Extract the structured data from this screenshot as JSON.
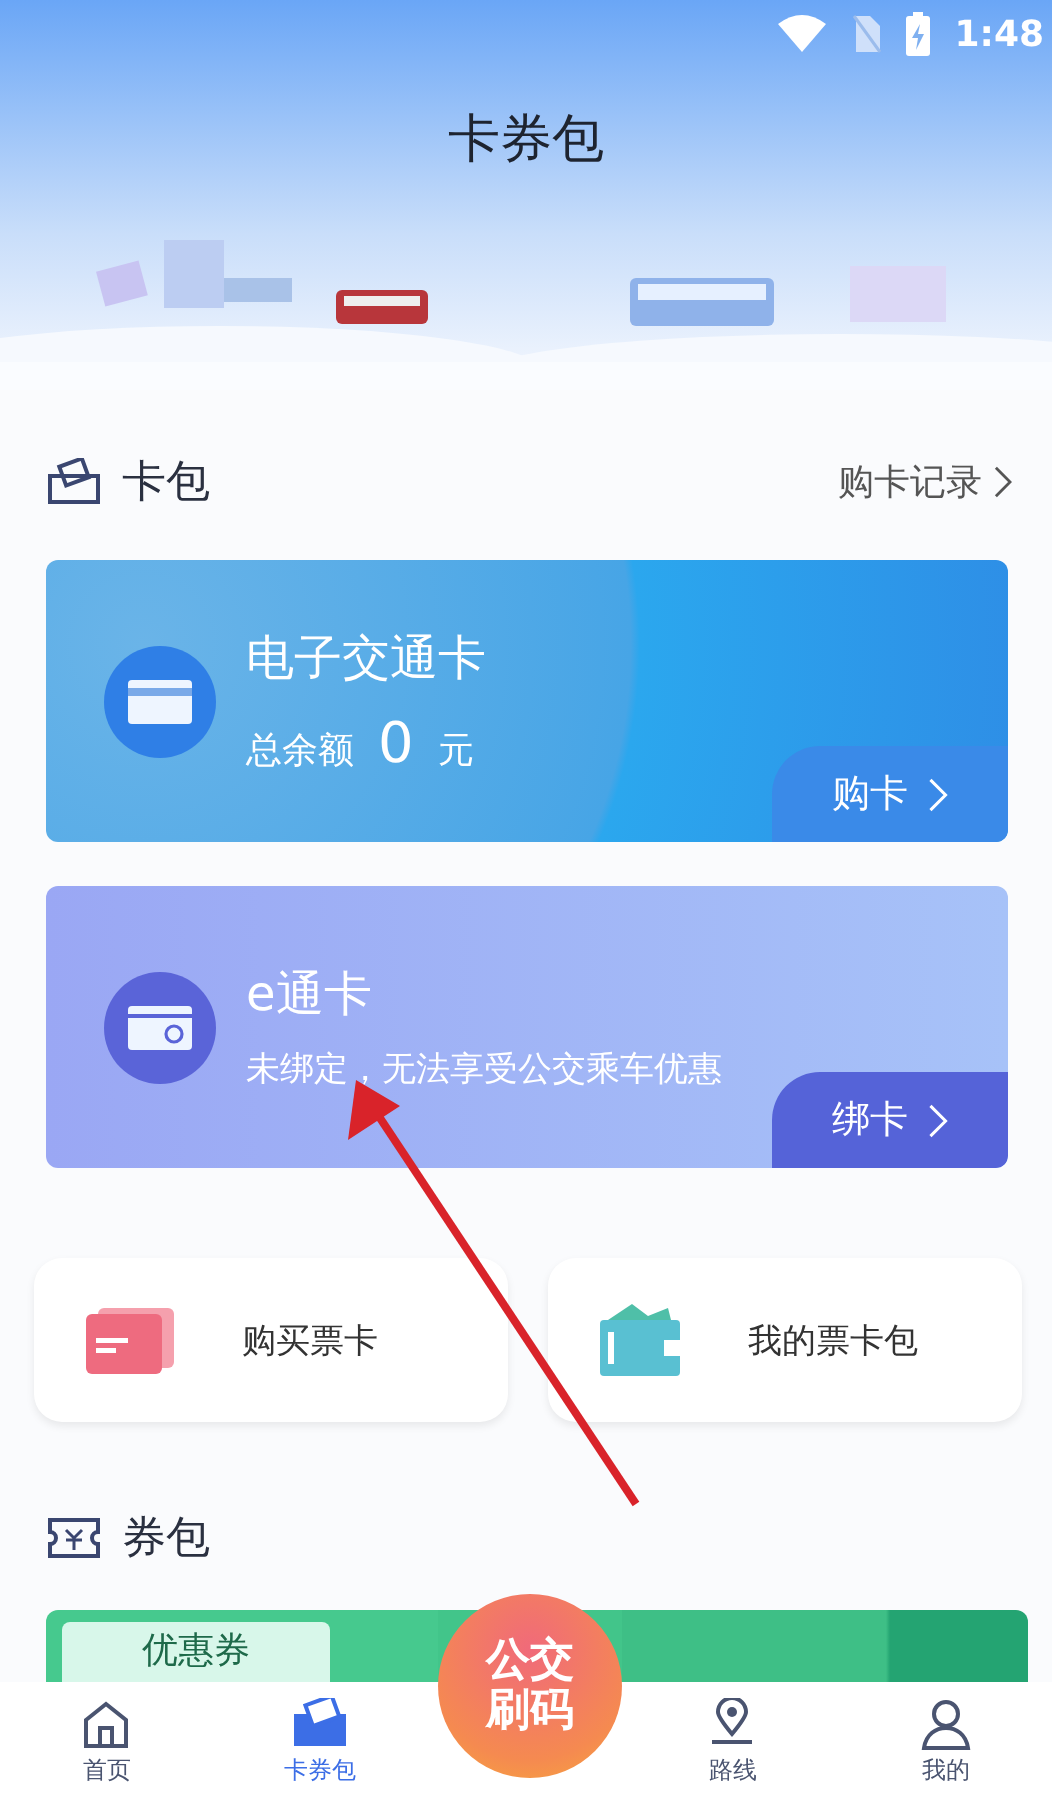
{
  "status_bar": {
    "time": "1:48"
  },
  "title": "卡券包",
  "card_wallet": {
    "title": "卡包",
    "link": "购卡记录"
  },
  "cards": [
    {
      "kind": "transit",
      "name": "电子交通卡",
      "balance_label": "总余额",
      "balance": "0",
      "unit": "元",
      "action": "购卡"
    },
    {
      "kind": "ecard",
      "name": "e通卡",
      "note": "未绑定，无法享受公交乘车优惠",
      "action": "绑卡"
    }
  ],
  "shortcuts": [
    {
      "kind": "buy",
      "label": "购买票卡"
    },
    {
      "kind": "wallet",
      "label": "我的票卡包"
    }
  ],
  "coupon_wallet": {
    "title": "券包",
    "banner_label": "优惠券"
  },
  "fab": {
    "lines": [
      "公交",
      "刷码"
    ]
  },
  "nav": [
    {
      "kind": "home",
      "label": "首页",
      "selected": false
    },
    {
      "kind": "cards",
      "label": "卡券包",
      "selected": true
    },
    {
      "kind": "route",
      "label": "路线",
      "selected": false
    },
    {
      "kind": "me",
      "label": "我的",
      "selected": false
    }
  ]
}
